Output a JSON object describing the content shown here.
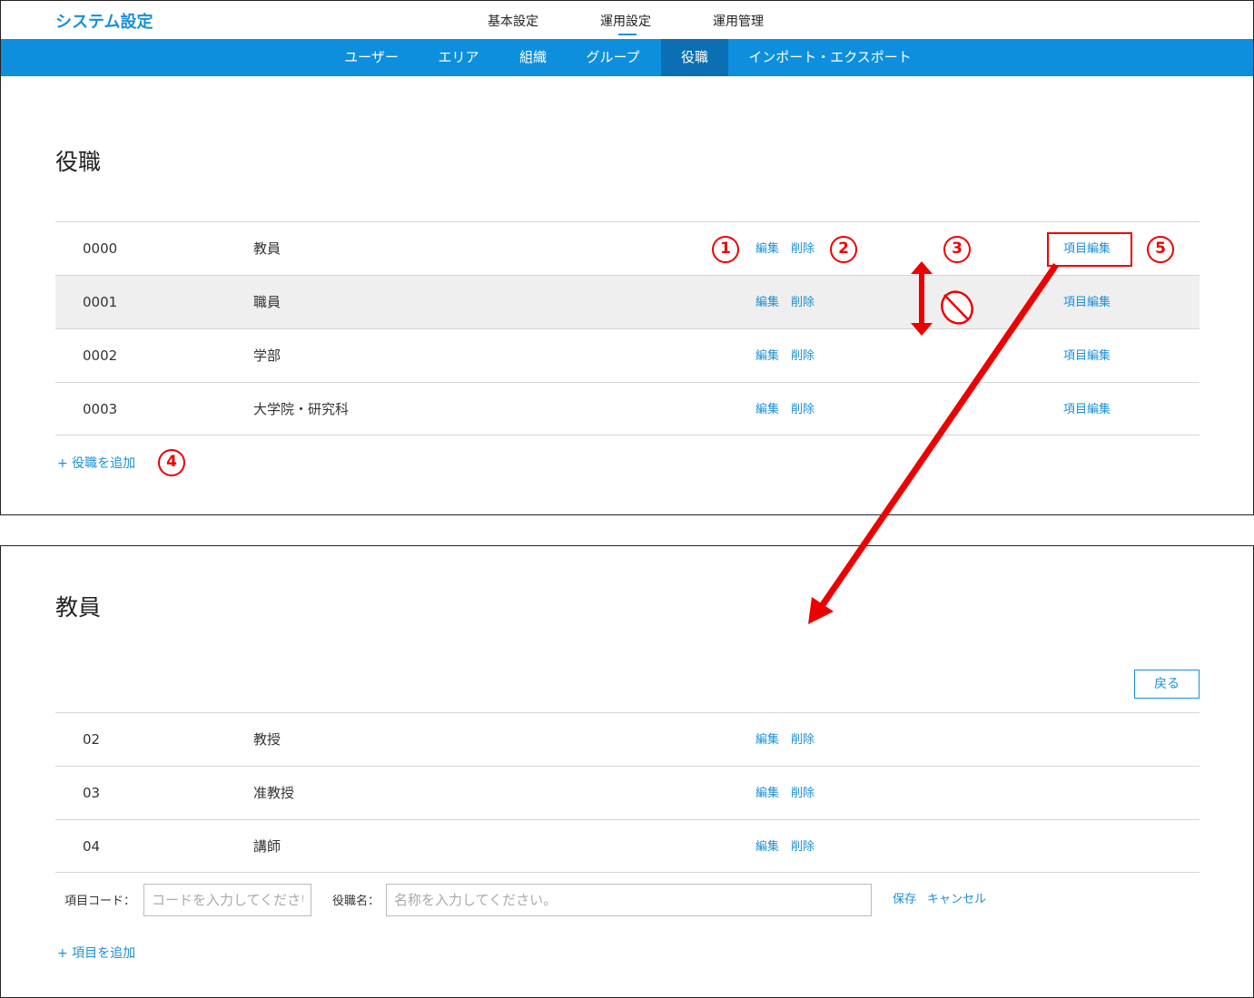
{
  "header": {
    "app_title": "システム設定",
    "top_nav": [
      "基本設定",
      "運用設定",
      "運用管理"
    ],
    "active_top_nav": "運用設定"
  },
  "subnav": {
    "items": [
      "ユーザー",
      "エリア",
      "組織",
      "グループ",
      "役職",
      "インポート・エクスポート"
    ],
    "active": "役職"
  },
  "positions_page": {
    "title": "役職",
    "rows": [
      {
        "code": "0000",
        "name": "教員",
        "edit": "編集",
        "delete": "削除",
        "item_edit": "項目編集"
      },
      {
        "code": "0001",
        "name": "職員",
        "edit": "編集",
        "delete": "削除",
        "item_edit": "項目編集"
      },
      {
        "code": "0002",
        "name": "学部",
        "edit": "編集",
        "delete": "削除",
        "item_edit": "項目編集"
      },
      {
        "code": "0003",
        "name": "大学院・研究科",
        "edit": "編集",
        "delete": "削除",
        "item_edit": "項目編集"
      }
    ],
    "add_label": "+ 役職を追加"
  },
  "items_page": {
    "title": "教員",
    "back_label": "戻る",
    "rows": [
      {
        "code": "02",
        "name": "教授",
        "edit": "編集",
        "delete": "削除"
      },
      {
        "code": "03",
        "name": "准教授",
        "edit": "編集",
        "delete": "削除"
      },
      {
        "code": "04",
        "name": "講師",
        "edit": "編集",
        "delete": "削除"
      }
    ],
    "form": {
      "code_label": "項目コード：",
      "code_placeholder": "コードを入力してください。",
      "name_label": "役職名：",
      "name_placeholder": "名称を入力してください。",
      "save_label": "保存",
      "cancel_label": "キャンセル"
    },
    "add_label": "+ 項目を追加"
  },
  "annotations": {
    "badges": [
      "1",
      "2",
      "3",
      "4",
      "5"
    ],
    "color": "#e00000",
    "icons": [
      "up-down-arrow-icon",
      "mouse-drag-icon",
      "diagonal-arrow-icon"
    ]
  },
  "colors": {
    "accent": "#1a8fd8",
    "subnav_bg": "#0e8fde",
    "subnav_active": "#0a6fb3"
  }
}
